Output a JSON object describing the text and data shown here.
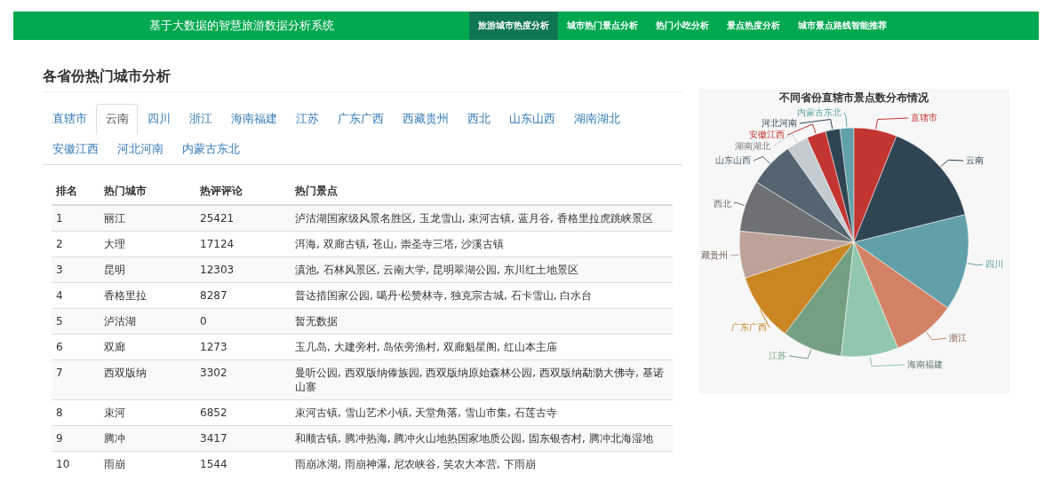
{
  "navbar": {
    "title": "基于大数据的智慧旅游数据分析系统",
    "items": [
      {
        "label": "旅游城市热度分析",
        "selected": true
      },
      {
        "label": "城市热门景点分析",
        "selected": false
      },
      {
        "label": "热门小吃分析",
        "selected": false
      },
      {
        "label": "景点热度分析",
        "selected": false
      },
      {
        "label": "城市景点路线智能推荐",
        "selected": false
      }
    ]
  },
  "heading": "各省份热门城市分析",
  "tabs": [
    {
      "label": "直辖市",
      "selected": false
    },
    {
      "label": "云南",
      "selected": true
    },
    {
      "label": "四川",
      "selected": false
    },
    {
      "label": "浙江",
      "selected": false
    },
    {
      "label": "海南福建",
      "selected": false
    },
    {
      "label": "江苏",
      "selected": false
    },
    {
      "label": "广东广西",
      "selected": false
    },
    {
      "label": "西藏贵州",
      "selected": false
    },
    {
      "label": "西北",
      "selected": false
    },
    {
      "label": "山东山西",
      "selected": false
    },
    {
      "label": "湖南湖北",
      "selected": false
    },
    {
      "label": "安徽江西",
      "selected": false
    },
    {
      "label": "河北河南",
      "selected": false
    },
    {
      "label": "内蒙古东北",
      "selected": false
    }
  ],
  "table": {
    "columns": [
      "排名",
      "热门城市",
      "热评评论",
      "热门景点"
    ],
    "rows": [
      [
        "1",
        "丽江",
        "25421",
        "泸沽湖国家级风景名胜区, 玉龙雪山, 束河古镇, 蓝月谷, 香格里拉虎跳峡景区"
      ],
      [
        "2",
        "大理",
        "17124",
        "洱海, 双廊古镇, 苍山, 崇圣寺三塔, 沙溪古镇"
      ],
      [
        "3",
        "昆明",
        "12303",
        "滇池, 石林风景区, 云南大学, 昆明翠湖公园, 东川红土地景区"
      ],
      [
        "4",
        "香格里拉",
        "8287",
        "普达措国家公园, 噶丹·松赞林寺, 独克宗古城, 石卡雪山, 白水台"
      ],
      [
        "5",
        "泸沽湖",
        "0",
        "暂无数据"
      ],
      [
        "6",
        "双廊",
        "1273",
        "玉几岛, 大建旁村, 岛依旁渔村, 双廊魁星阁, 红山本主庙"
      ],
      [
        "7",
        "西双版纳",
        "3302",
        "曼听公园, 西双版纳傣族园, 西双版纳原始森林公园, 西双版纳勐泐大佛寺, 基诺山寨"
      ],
      [
        "8",
        "束河",
        "6852",
        "束河古镇, 雪山艺术小镇, 天堂角落, 雪山市集, 石莲古寺"
      ],
      [
        "9",
        "腾冲",
        "3417",
        "和顺古镇, 腾冲热海, 腾冲火山地热国家地质公园, 固东银杏村, 腾冲北海湿地"
      ],
      [
        "10",
        "雨崩",
        "1544",
        "雨崩冰湖, 雨崩神瀑, 尼农峡谷, 笑农大本营, 下雨崩"
      ]
    ]
  },
  "pie": {
    "title": "不同省份直辖市景点数分布情况",
    "slices": [
      {
        "label": "内蒙古东北",
        "color": "#61a0a8"
      },
      {
        "label": "直辖市",
        "color": "#c23531"
      },
      {
        "label": "河北河南",
        "color": "#2f4554"
      },
      {
        "label": "安徽江西",
        "color": "#c23531"
      },
      {
        "label": "湖南湖北",
        "color": "#c4ccd3"
      },
      {
        "label": "山东山西",
        "color": "#546570"
      },
      {
        "label": "云南",
        "color": "#2f4554"
      },
      {
        "label": "西北",
        "color": "#6e7074"
      },
      {
        "label": "藏贵州",
        "color": "#bda29a"
      },
      {
        "label": "四川",
        "color": "#61a0a8"
      },
      {
        "label": "广东广西",
        "color": "#ca8622"
      },
      {
        "label": "浙江",
        "color": "#d48265"
      },
      {
        "label": "江苏",
        "color": "#749f83"
      },
      {
        "label": "海南福建",
        "color": "#91c7ae"
      }
    ]
  }
}
